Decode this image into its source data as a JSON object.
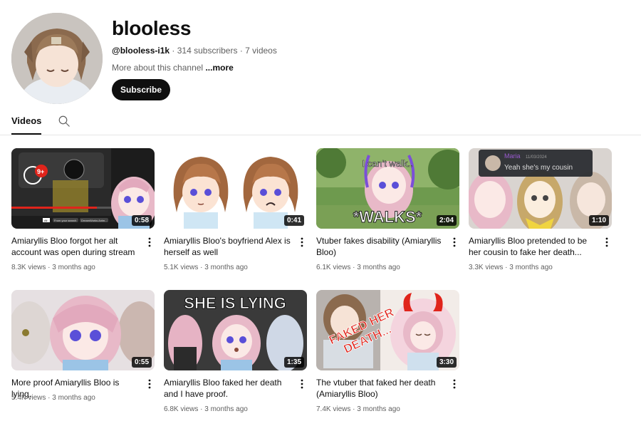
{
  "channel": {
    "name": "blooless",
    "handle": "@blooless-i1k",
    "subscribers": "314 subscribers",
    "video_count": "7 videos",
    "about": "More about this channel",
    "more_link": "...more",
    "subscribe_label": "Subscribe"
  },
  "tabs": {
    "videos_label": "Videos"
  },
  "videos": [
    {
      "title": "Amiaryllis Bloo forgot her alt account was open during stream",
      "duration": "0:58",
      "views": "8.3K views",
      "age": "3 months ago"
    },
    {
      "title": "Amiaryllis Bloo's boyfriend Alex is herself as well",
      "duration": "0:41",
      "views": "5.1K views",
      "age": "3 months ago"
    },
    {
      "title": "Vtuber fakes disability (Amiaryllis Bloo)",
      "duration": "2:04",
      "views": "6.1K views",
      "age": "3 months ago"
    },
    {
      "title": "Amiaryllis Bloo pretended to be her cousin to fake her death...",
      "duration": "1:10",
      "views": "3.3K views",
      "age": "3 months ago"
    },
    {
      "title": "More proof Amiaryllis Bloo is lying.",
      "duration": "0:55",
      "views": "5.4K views",
      "age": "3 months ago"
    },
    {
      "title": "Amiaryllis Bloo faked her death and I have proof.",
      "duration": "1:35",
      "views": "6.8K views",
      "age": "3 months ago"
    },
    {
      "title": "The vtuber that faked her death (Amiaryllis Bloo)",
      "duration": "3:30",
      "views": "7.4K views",
      "age": "3 months ago"
    }
  ],
  "thumb_text": {
    "notif_badge": "9+",
    "cant_walk": "I can't walk..",
    "walks": "*WALKS*",
    "chat_user": "Maria",
    "chat_date": "11/03/2024",
    "chat_msg": "Yeah she's my cousin",
    "she_is_lying": "SHE IS LYING",
    "faked_line1": "FAKED HER",
    "faked_line2": "DEATH...",
    "ui_label_1": "All",
    "ui_label_2": "From your search",
    "ui_label_3": "DreamWorks Anim..."
  },
  "colors": {
    "accent": "#0f0f0f",
    "meta": "#606060",
    "badge_red": "#e0241b",
    "chat_name": "#9a5ad0"
  }
}
